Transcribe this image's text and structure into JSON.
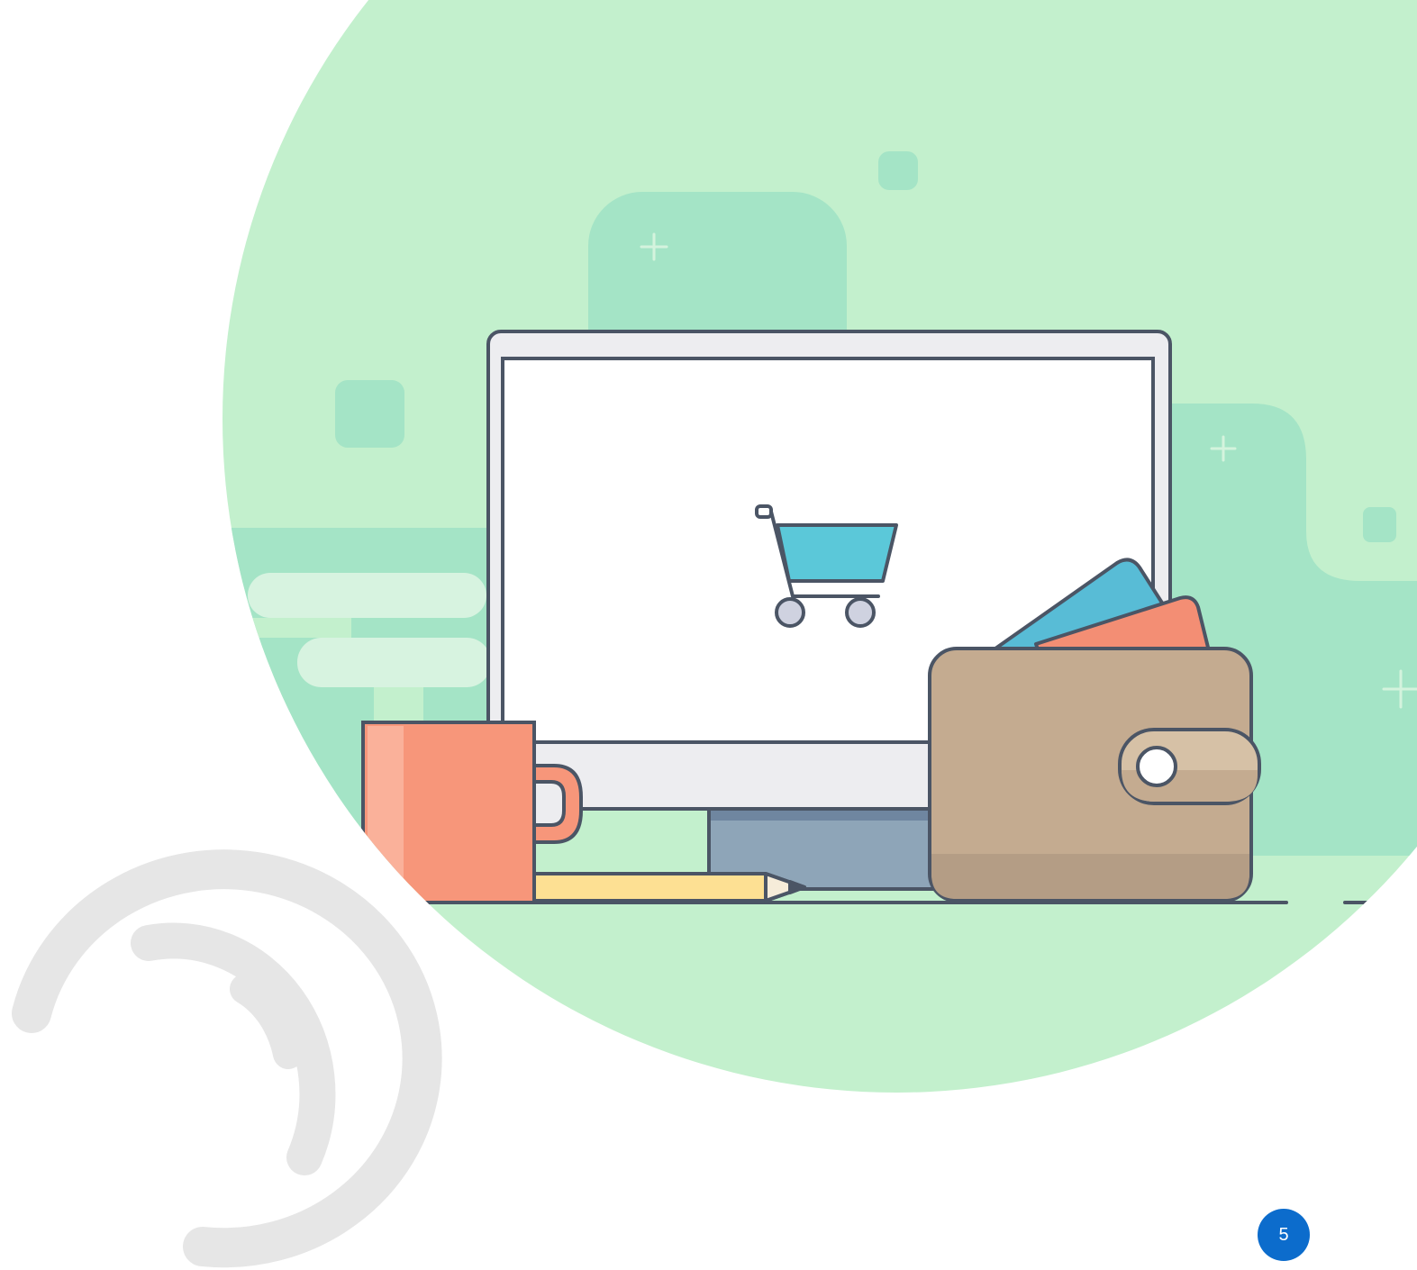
{
  "slide": {
    "page_number": "5"
  },
  "illustration": {
    "icon": "shopping-cart-icon",
    "objects": [
      "desktop-monitor",
      "coffee-mug",
      "pencil",
      "wallet",
      "payment-cards"
    ]
  },
  "colors": {
    "background": "#ffffff",
    "circle_green": "#c3f0cd",
    "shape_green": "#a4e4c6",
    "outline": "#4b5565",
    "cart_blue": "#5bc8d9",
    "mug_orange": "#f7967a",
    "wallet_tan": "#c4ab90",
    "card_blue": "#58bcd6",
    "card_orange": "#f38e74",
    "pencil_yellow": "#fde093",
    "stand_gray": "#8ea5b8",
    "swoosh_gray": "#e6e6e6",
    "badge_blue": "#0c6ccc"
  }
}
